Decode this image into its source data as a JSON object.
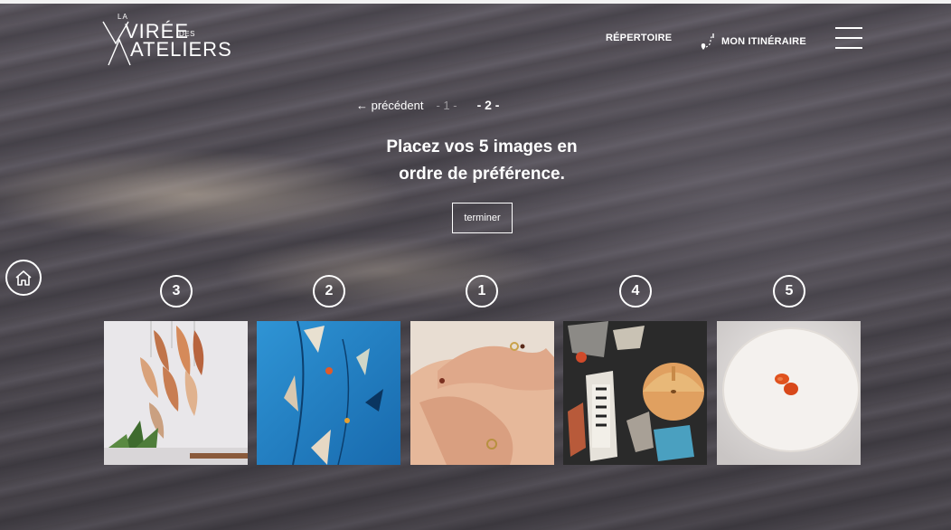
{
  "logo": {
    "la": "LA",
    "line1": "VIRÉE",
    "des": "DES",
    "line2": "ATELIERS"
  },
  "nav": {
    "repertoire": "RÉPERTOIRE",
    "itinerary": "MON ITINÉRAIRE"
  },
  "pager": {
    "previous": "← précédent",
    "page1": "- 1 -",
    "page2": "- 2 -"
  },
  "title": {
    "line1": "Placez vos 5 images en",
    "line2": "ordre de préférence."
  },
  "finish_label": "terminer",
  "ranks": [
    "3",
    "2",
    "1",
    "4",
    "5"
  ],
  "images": [
    {
      "name": "wood-petal-lamp"
    },
    {
      "name": "blue-abstract-painting"
    },
    {
      "name": "hands-with-rings"
    },
    {
      "name": "collage-with-wooden-vessel"
    },
    {
      "name": "white-plate-with-fruit"
    }
  ],
  "colors": {
    "text": "#ffffff",
    "accent_top": "#f2f2f2"
  }
}
